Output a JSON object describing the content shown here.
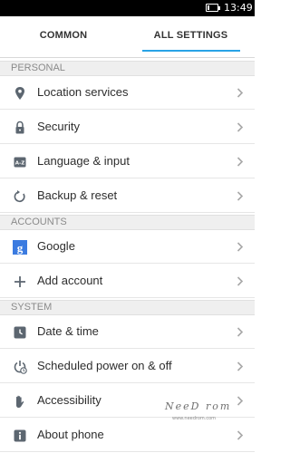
{
  "status_bar": {
    "time": "13:49",
    "battery_level": 0.2
  },
  "tabs": {
    "common": "COMMON",
    "all_settings": "ALL SETTINGS",
    "active": "all_settings",
    "accent_color": "#29a3e6"
  },
  "sections": {
    "personal": "PERSONAL",
    "accounts": "ACCOUNTS",
    "system": "SYSTEM"
  },
  "items": {
    "location": {
      "label": "Location services",
      "icon": "location-pin-icon"
    },
    "security": {
      "label": "Security",
      "icon": "lock-icon"
    },
    "language": {
      "label": "Language & input",
      "icon": "keyboard-az-icon"
    },
    "backup": {
      "label": "Backup & reset",
      "icon": "refresh-icon"
    },
    "google": {
      "label": "Google",
      "icon": "google-icon"
    },
    "add_account": {
      "label": "Add account",
      "icon": "plus-icon"
    },
    "date_time": {
      "label": "Date & time",
      "icon": "clock-icon"
    },
    "scheduled_power": {
      "label": "Scheduled power on & off",
      "icon": "power-clock-icon"
    },
    "accessibility": {
      "label": "Accessibility",
      "icon": "hand-icon"
    },
    "about": {
      "label": "About phone",
      "icon": "info-icon"
    }
  },
  "watermark": {
    "text": "NeeD rom",
    "sub": "www.needrom.com"
  }
}
